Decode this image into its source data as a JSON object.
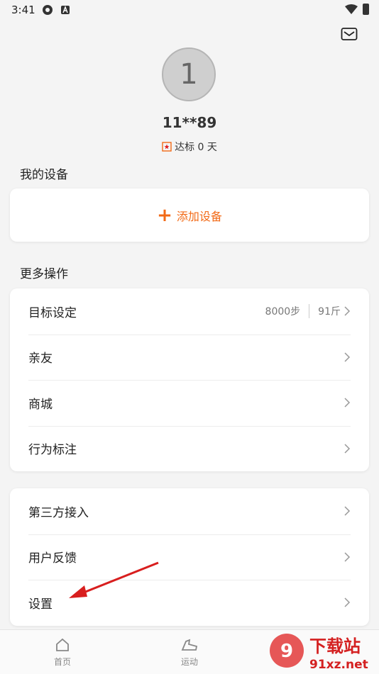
{
  "status": {
    "time": "3:41"
  },
  "profile": {
    "avatar_letter": "1",
    "username": "11**89",
    "badge_text": "达标 0 天"
  },
  "devices": {
    "title": "我的设备",
    "add_label": "添加设备"
  },
  "more": {
    "title": "更多操作",
    "items": [
      {
        "label": "目标设定",
        "steps": "8000步",
        "weight": "91斤"
      },
      {
        "label": "亲友"
      },
      {
        "label": "商城"
      },
      {
        "label": "行为标注"
      }
    ]
  },
  "other": {
    "items": [
      {
        "label": "第三方接入"
      },
      {
        "label": "用户反馈"
      },
      {
        "label": "设置"
      }
    ]
  },
  "tabs": [
    {
      "label": "首页"
    },
    {
      "label": "运动"
    }
  ],
  "watermark": {
    "text1": "下载站",
    "text2": "91xz.net"
  },
  "colors": {
    "accent": "#f26a17",
    "arrow": "#d81e1e"
  }
}
